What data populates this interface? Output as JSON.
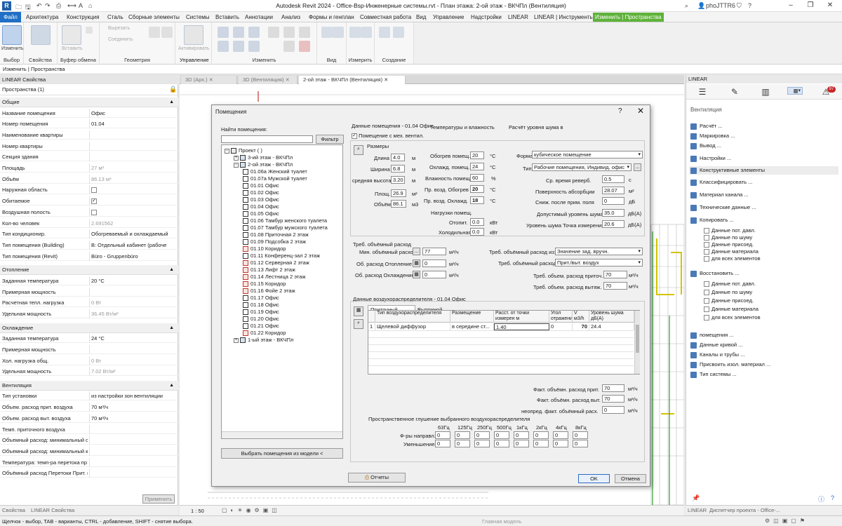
{
  "titlebar": {
    "logo": "R",
    "title": "Autodesk Revit 2024 - Office-Bsp-Инженерные системы.rvt - План этажа: 2-ой этаж - ВКЧПл (Вентиляция)",
    "user": "phoJTTR6"
  },
  "menu": [
    "Файл",
    "Архитектура",
    "Конструкция",
    "Сталь",
    "Сборные элементы",
    "Системы",
    "Вставить",
    "Аннотации",
    "Анализ",
    "Формы и генплан",
    "Совместная работа",
    "Вид",
    "Управление",
    "Надстройки",
    "LINEAR",
    "LINEAR | Инструменты",
    "Изменить | Пространства"
  ],
  "ribbon": {
    "panels": [
      "Выбор",
      "Свойства",
      "Буфер обмена",
      "Геометрия",
      "Изменить",
      "Вид",
      "Измерить",
      "Создание",
      "Управление"
    ],
    "tools": [
      "Изменить",
      "Вставить",
      "Вырезать",
      "Соединить",
      "Активировать"
    ]
  },
  "optionsbar": "Изменить | Пространства",
  "properties": {
    "header": "LINEAR Свойства",
    "type": "Пространства (1)",
    "groups": [
      {
        "name": "Общие",
        "rows": [
          {
            "k": "Название помещения",
            "v": "Офис"
          },
          {
            "k": "Номер помещения",
            "v": "01.04"
          },
          {
            "k": "Наименование квартиры",
            "v": ""
          },
          {
            "k": "Номер квартиры",
            "v": ""
          },
          {
            "k": "Секция здания",
            "v": ""
          },
          {
            "k": "Площадь",
            "v": "27 м²",
            "g": true
          },
          {
            "k": "Объём",
            "v": "86.13 м³",
            "g": true
          },
          {
            "k": "Наружная область",
            "v": "",
            "chk": false
          },
          {
            "k": "Обитаемое",
            "v": "",
            "chk": true
          },
          {
            "k": "Воздушная полость",
            "v": "",
            "chk": false
          },
          {
            "k": "Кол-во человек",
            "v": "2.691562",
            "g": true
          },
          {
            "k": "Тип кондиционир.",
            "v": "Обогреваемый и охлаждаемый"
          },
          {
            "k": "Тип помещения (Building)",
            "v": "B: Отдельный кабинет (рабоче"
          },
          {
            "k": "Тип помещения (Revit)",
            "v": "Büro - Gruppenbüro"
          }
        ]
      },
      {
        "name": "Отопление",
        "rows": [
          {
            "k": "Заданная температура",
            "v": "20 °C"
          },
          {
            "k": "Примерная мощность",
            "v": ""
          },
          {
            "k": "Расчетная тепл. нагрузка",
            "v": "0 Вт",
            "g": true
          },
          {
            "k": "Удельная мощность",
            "v": "36.45 Вт/м²",
            "g": true
          }
        ]
      },
      {
        "name": "Охлаждение",
        "rows": [
          {
            "k": "Заданная температура",
            "v": "24 °C"
          },
          {
            "k": "Примерная мощность",
            "v": ""
          },
          {
            "k": "Хол. нагрузка общ.",
            "v": "0 Вт",
            "g": true
          },
          {
            "k": "Удельная мощность",
            "v": "7.02 Вт/м²",
            "g": true
          }
        ]
      },
      {
        "name": "Вентиляция",
        "rows": [
          {
            "k": "Тип установки",
            "v": "из настройки зон вентиляции"
          },
          {
            "k": "Объем. расход прит. воздуха",
            "v": "70 м³/ч"
          },
          {
            "k": "Объем. расход выт. воздуха",
            "v": "70 м³/ч"
          },
          {
            "k": "Темп. приточного воздуха",
            "v": ""
          },
          {
            "k": "Объемный расход: минимальный с",
            "v": ""
          },
          {
            "k": "Объемный расход: минимальный к",
            "v": ""
          },
          {
            "k": "Температура: темп-ра перетока пр",
            "v": ""
          },
          {
            "k": "Объёмный расход Перетоки Прит. в",
            "v": ""
          }
        ]
      }
    ],
    "apply": "Применить",
    "foot_tabs": [
      "Свойства",
      "LINEAR Свойства"
    ]
  },
  "view_tabs": [
    "3D (Арх.)",
    "3D (Вентиляция)",
    "2-ой этаж - ВКЧПл (Вентиляция)"
  ],
  "dialog": {
    "title": "Помещения",
    "search_label": "Найти помещения:",
    "filter_btn": "Фильтр",
    "tree": [
      {
        "t": "Проект ( )",
        "lvl": 0,
        "exp": "−"
      },
      {
        "t": "3-ий этаж - ВКЧПл",
        "lvl": 1,
        "exp": "+"
      },
      {
        "t": "2-ой этаж - ВКЧПл",
        "lvl": 1,
        "exp": "−"
      },
      {
        "t": "01.06а Женский туалет",
        "lvl": 2
      },
      {
        "t": "01.07а Мужской туалет",
        "lvl": 2
      },
      {
        "t": "01.01 Офис",
        "lvl": 2
      },
      {
        "t": "01.02 Офис",
        "lvl": 2
      },
      {
        "t": "01.03 Офис",
        "lvl": 2
      },
      {
        "t": "01.04 Офис",
        "lvl": 2
      },
      {
        "t": "01.05 Офис",
        "lvl": 2
      },
      {
        "t": "01.06 Тамбур женского туалета",
        "lvl": 2
      },
      {
        "t": "01.07 Тамбур мужского туалета",
        "lvl": 2
      },
      {
        "t": "01.08 Приточная 2 этаж",
        "lvl": 2
      },
      {
        "t": "01.09 Подсобка 2 этаж",
        "lvl": 2
      },
      {
        "t": "01.10 Коридор",
        "lvl": 2,
        "red": true
      },
      {
        "t": "01.11 Конференц-зал 2 этаж",
        "lvl": 2
      },
      {
        "t": "01.12 Серверная 2 этаж",
        "lvl": 2,
        "red": true
      },
      {
        "t": "01.13 Лифт 2 этаж",
        "lvl": 2,
        "red": true
      },
      {
        "t": "01.14 Лестница 2 этаж",
        "lvl": 2,
        "red": true
      },
      {
        "t": "01.15 Коридор",
        "lvl": 2,
        "red": true
      },
      {
        "t": "01.16 Фойе 2 этаж",
        "lvl": 2,
        "red": true
      },
      {
        "t": "01.17 Офис",
        "lvl": 2
      },
      {
        "t": "01.18 Офис",
        "lvl": 2
      },
      {
        "t": "01.19 Офис",
        "lvl": 2
      },
      {
        "t": "01.20 Офис",
        "lvl": 2
      },
      {
        "t": "01.21 Офис",
        "lvl": 2
      },
      {
        "t": "01.22 Коридор",
        "lvl": 2,
        "red": true
      },
      {
        "t": "1-ый этаж - ВКЧПл",
        "lvl": 1,
        "exp": "+"
      }
    ],
    "pick_btn": "Выбрать помещения из модели <",
    "room_title": "Данные помещения - 01.04 Офис",
    "mech_vent": "Помещение с мех. вентил.",
    "dims": {
      "title": "Размеры",
      "length_l": "Длина",
      "length": "4.0",
      "width_l": "Ширина",
      "width": "6.8",
      "height_l": "средняя высота",
      "height": "3.20",
      "area_l": "Площ.",
      "area": "26.9",
      "vol_l": "Объём",
      "vol": "86.1",
      "u_m": "м",
      "u_m2": "м²",
      "u_m3": "м3"
    },
    "temps": {
      "title": "Температуры и влажность",
      "heat_l": "Обогрев помещ.",
      "heat": "20",
      "cool_l": "Охлажд. помещ.",
      "cool": "24",
      "hum_l": "Влажность помещ.",
      "hum": "60",
      "sup_h_l": "Пр. возд. Обогрев",
      "sup_h": "20",
      "sup_c_l": "Пр. возд. Охлажд.",
      "sup_c": "18",
      "u_c": "°C",
      "u_p": "%"
    },
    "loads": {
      "title": "Нагрузки помещ.",
      "heat_l": "Отопит.",
      "heat": "0.0",
      "cool_l": "Холодильная",
      "cool": "0.0",
      "u": "кВт"
    },
    "noise": {
      "title": "Расчёт уровня шума в",
      "form_l": "Форма",
      "form": "кубическое помещение",
      "type_l": "Тип",
      "type": "Рабочие помещения, Индивид. офис",
      "rev_l": "Ср. время реверб.",
      "rev": "0.5",
      "u_rev": "с",
      "abs_l": "Поверхность абсорбции",
      "abs": "28.07",
      "u_abs": "м²",
      "red_l": "Сниж. после прим. поля",
      "red": "0",
      "u_red": "дБ",
      "perm_l": "Допустимый уровень шума",
      "perm": "35.0",
      "u_perm": "дБ(А)",
      "lvl_l": "Уровень шума Точка измерения",
      "lvl": "20.6",
      "u_lvl": "дБ(А)"
    },
    "flow": {
      "title": "Треб. объёмный расход",
      "min_l": "Мин. объёмный расход",
      "min": "77",
      "heat_l": "Об. расход Отопление",
      "heat": "0",
      "cool_l": "Об. расход Охлаждение",
      "cool": "0",
      "u": "м³/ч",
      "from_l": "Треб. объёмный расход из:",
      "from": "Значение зад. вручн.",
      "req_l": "Треб. объёмный расход",
      "req": "Прит./выт. воздух",
      "sup_l": "Треб. объем. расход приточ.",
      "sup": "70",
      "exh_l": "Треб. объем. расход вытяж.",
      "exh": "70"
    },
    "diff": {
      "title": "Данные воздухораспределителя - 01.04 Офис",
      "tab1": "Приточный воздух",
      "tab2": "Вытяжной воздух",
      "cols": [
        "Тип воздухораспределителя",
        "Размещение",
        "Расст. от точки измерен м",
        "Угол отражени",
        "V м3/h",
        "Уровень шума дБ(А)"
      ],
      "row": {
        "n": "1",
        "type": "Щелевой диффузор",
        "place": "в середине ст...",
        "dist": "1.40",
        "angle": "0",
        "v": "70",
        "noise": "24.4"
      }
    },
    "facts": {
      "sup_l": "Факт. объёмн. расход прит.",
      "sup": "70",
      "exh_l": "Факт. объёмн. расход выт.",
      "exh": "70",
      "diff_l": "неопред. факт. объёмный расх.",
      "diff": "0",
      "u": "м³/ч"
    },
    "octave": {
      "title": "Пространственное глушение выбранного воздухораспределителя",
      "bands": [
        "63Гц",
        "125Гц",
        "250Гц",
        "500Гц",
        "1кГц",
        "2кГц",
        "4кГц",
        "8кГц"
      ],
      "row1": "Ф-ры направл.",
      "row2": "Уменьшение",
      "vals1": [
        "0",
        "0",
        "0",
        "0",
        "0",
        "0",
        "0",
        "0"
      ],
      "vals2": [
        "0",
        "0",
        "0",
        "0",
        "0",
        "0",
        "0",
        "0"
      ]
    },
    "reports_btn": "Отчеты",
    "ok_btn": "OK",
    "cancel_btn": "Отмена"
  },
  "right_panel": {
    "header": "LINEAR",
    "section": "Вентиляция",
    "items": [
      "Расчёт ...",
      "Маркировка ...",
      "Вывод ...",
      "Настройки ...",
      "Конструктивные элементы",
      "Классифицировать ...",
      "Материал канала ...",
      "Технические данные ...",
      "Копировать ...",
      "Восстановить ...",
      "помещения ...",
      "Данные кривой ...",
      "Каналы и трубы ...",
      "Присвоить изол. материал ...",
      "Тип системы ..."
    ],
    "copy_sub": [
      "Данные пот. давл.",
      "Данные по шуму",
      "Данные присоед.",
      "Данные материала",
      "для всех элементов"
    ],
    "restore_sub": [
      "Данные пот. давл.",
      "Данные по шуму",
      "Данные присоед.",
      "Данные материала",
      "для всех элементов"
    ],
    "badge": "97",
    "foot_tabs": [
      "LINEAR",
      "Диспетчер проекта - Office-..."
    ]
  },
  "viewctl": {
    "scale": "1 : 50",
    "model": "Главная модель"
  },
  "status": "Щелчок - выбор, TAB - варианты, CTRL - добавление, SHIFT - снятие выбора."
}
